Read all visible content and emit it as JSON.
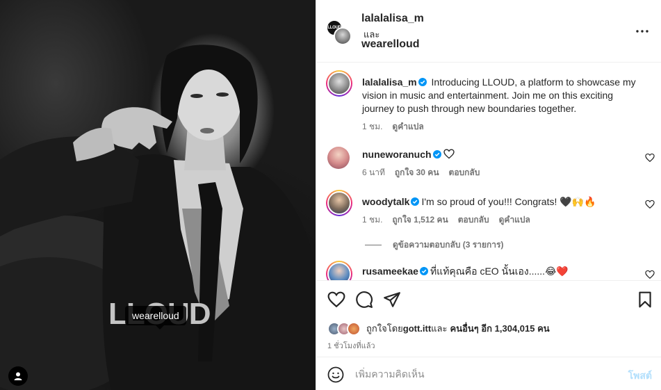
{
  "image": {
    "logo_text": "LLOUD",
    "tag_label": "wearelloud"
  },
  "header": {
    "author": "lalalalisa_m",
    "and": "และ",
    "collaborator": "wearelloud",
    "collab_badge": "LLOUD"
  },
  "caption": {
    "username": "lalalalisa_m",
    "text": " Introducing LLOUD, a platform to showcase my vision in music and entertainment. Join me on this exciting journey to push through new boundaries together.",
    "time": "1 ชม.",
    "translate": "ดูคำแปล"
  },
  "comments": [
    {
      "username": "nuneworanuch",
      "text": "",
      "time": "6 นาที",
      "likes": "ถูกใจ 30 คน",
      "reply": "ตอบกลับ"
    },
    {
      "username": "woodytalk",
      "text": "I'm so proud of you!!! Congrats! 🖤🙌🔥",
      "time": "1 ชม.",
      "likes": "ถูกใจ 1,512 คน",
      "reply": "ตอบกลับ",
      "translate": "ดูคำแปล",
      "view_replies": "ดูข้อความตอบกลับ (3 รายการ)"
    },
    {
      "username": "rusameekae",
      "text": "ที่แท้คุณคือ cEO นั้นเอง......😂❤️"
    }
  ],
  "likes": {
    "prefix": "ถูกใจโดย ",
    "user": "gott.itt",
    "middle": " และ",
    "others": "คนอื่นๆ อีก 1,304,015 คน"
  },
  "posted": "1 ชั่วโมงที่แล้ว",
  "add_comment": {
    "placeholder": "เพิ่มความคิดเห็น",
    "post_label": "โพสต์"
  },
  "colors": {
    "verified": "#0095f6",
    "muted": "#737373",
    "post_disabled": "#b2dffc"
  }
}
